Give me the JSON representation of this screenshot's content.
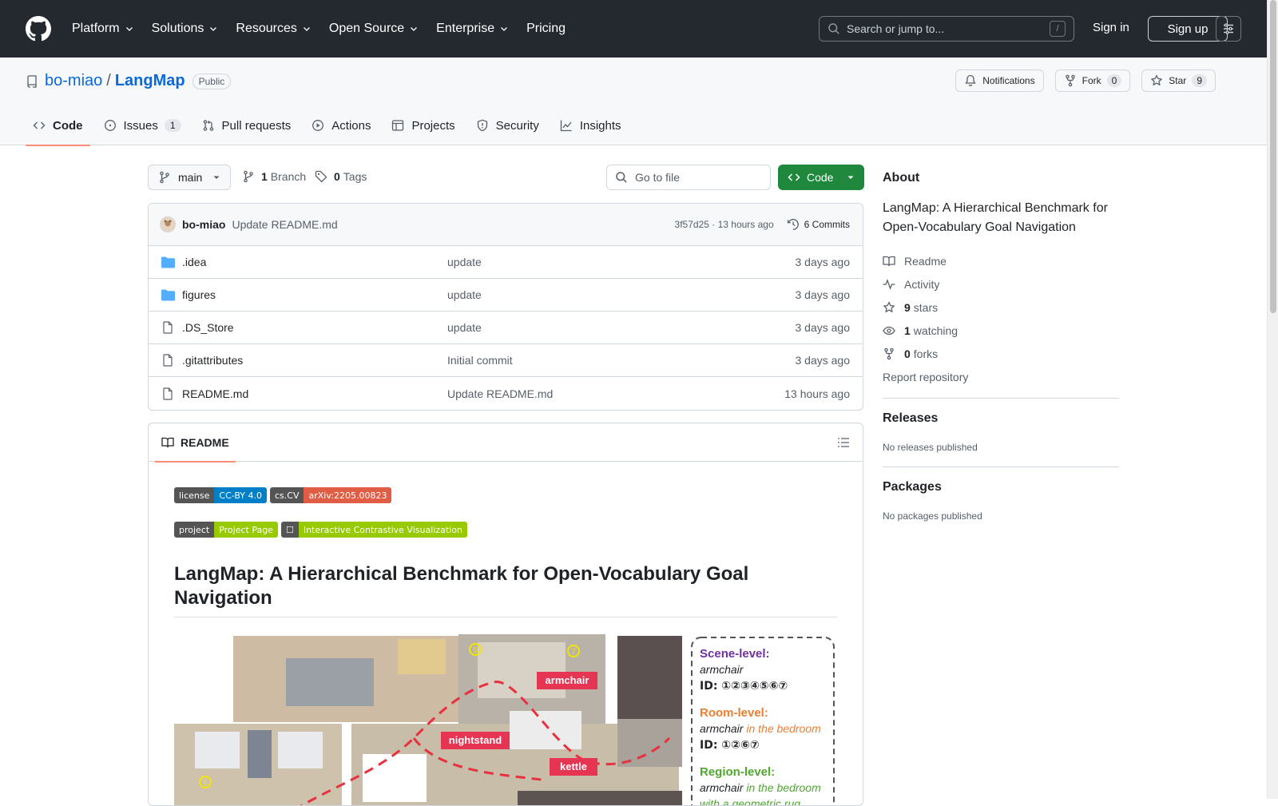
{
  "header": {
    "nav": [
      "Platform",
      "Solutions",
      "Resources",
      "Open Source",
      "Enterprise",
      "Pricing"
    ],
    "search_placeholder": "Search or jump to...",
    "search_key": "/",
    "sign_in": "Sign in",
    "sign_up": "Sign up"
  },
  "repo": {
    "owner": "bo-miao",
    "separator": "/",
    "name": "LangMap",
    "visibility": "Public",
    "actions": {
      "notifications": "Notifications",
      "fork": "Fork",
      "fork_count": "0",
      "star": "Star",
      "star_count": "9"
    },
    "tabs": [
      {
        "label": "Code"
      },
      {
        "label": "Issues",
        "count": "1"
      },
      {
        "label": "Pull requests"
      },
      {
        "label": "Actions"
      },
      {
        "label": "Projects"
      },
      {
        "label": "Security"
      },
      {
        "label": "Insights"
      }
    ]
  },
  "filebar": {
    "branch": "main",
    "branch_count": "1",
    "branch_label": "Branch",
    "tag_count": "0",
    "tag_label": "Tags",
    "goto_placeholder": "Go to file",
    "code_button": "Code"
  },
  "commit": {
    "author": "bo-miao",
    "message": "Update README.md",
    "meta": "3f57d25 · 13 hours ago",
    "commits": "6 Commits"
  },
  "files": [
    {
      "type": "dir",
      "name": ".idea",
      "message": "update",
      "age": "3 days ago"
    },
    {
      "type": "dir",
      "name": "figures",
      "message": "update",
      "age": "3 days ago"
    },
    {
      "type": "file",
      "name": ".DS_Store",
      "message": "update",
      "age": "3 days ago"
    },
    {
      "type": "file",
      "name": ".gitattributes",
      "message": "Initial commit",
      "age": "3 days ago"
    },
    {
      "type": "file",
      "name": "README.md",
      "message": "Update README.md",
      "age": "13 hours ago"
    }
  ],
  "readme": {
    "tab": "README",
    "badges": [
      {
        "left": "license",
        "right": "CC-BY 4.0",
        "color": "#007ec6"
      },
      {
        "left": "cs.CV",
        "right": "arXiv:2205.00823",
        "color": "#e05d44"
      },
      {
        "left": "project",
        "right": "Project Page",
        "color": "#97ca00"
      },
      {
        "left": "☐",
        "right": "Interactive Contrastive Visualization",
        "color": "#97ca00"
      }
    ],
    "title": "LangMap: A Hierarchical Benchmark for Open-Vocabulary Goal Navigation",
    "figure": {
      "labels": [
        "armchair",
        "nightstand",
        "kettle"
      ],
      "markers": [
        "1",
        "5",
        "7"
      ],
      "scene_level": "Scene-level:",
      "scene_text": "armchair",
      "scene_id": "ID: ①②③④⑤⑥⑦",
      "room_level": "Room-level:",
      "room_text": "armchair",
      "room_suffix": " in the bedroom",
      "room_id": "ID: ①②⑥⑦",
      "region_level": "Region-level:",
      "region_text": "armchair",
      "region_suffix": " in the bedroom",
      "region_line2": "with a geometric rug"
    }
  },
  "about": {
    "heading": "About",
    "description": "LangMap: A Hierarchical Benchmark for Open-Vocabulary Goal Navigation",
    "readme": "Readme",
    "activity": "Activity",
    "stars_count": "9",
    "stars_label": "stars",
    "watching_count": "1",
    "watching_label": "watching",
    "forks_count": "0",
    "forks_label": "forks",
    "report": "Report repository"
  },
  "releases": {
    "heading": "Releases",
    "empty": "No releases published"
  },
  "packages": {
    "heading": "Packages",
    "empty": "No packages published"
  },
  "colors": {
    "header_bg": "#24292f",
    "link": "#0969da",
    "primary_button": "#1f883d",
    "tab_underline": "#fd8c73"
  }
}
